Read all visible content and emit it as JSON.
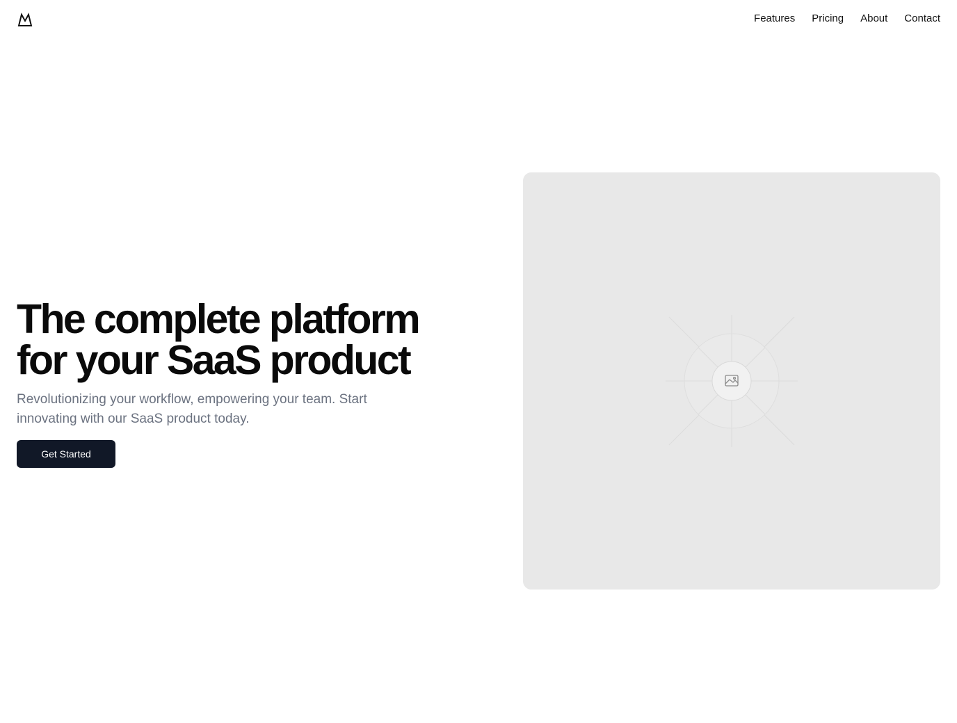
{
  "header": {
    "logo_icon": "mountain-logo-icon",
    "nav": [
      {
        "label": "Features"
      },
      {
        "label": "Pricing"
      },
      {
        "label": "About"
      },
      {
        "label": "Contact"
      }
    ]
  },
  "hero": {
    "title_line1": "The complete platform",
    "title_line2": "for your SaaS product",
    "subtitle": "Revolutionizing your workflow, empowering your team. Start innovating with our SaaS product today.",
    "cta_label": "Get Started",
    "image_icon": "image-placeholder-icon"
  },
  "colors": {
    "text": "#0a0a0a",
    "muted": "#6b7280",
    "button_bg": "#111827",
    "placeholder_bg": "#e8e8e8"
  }
}
